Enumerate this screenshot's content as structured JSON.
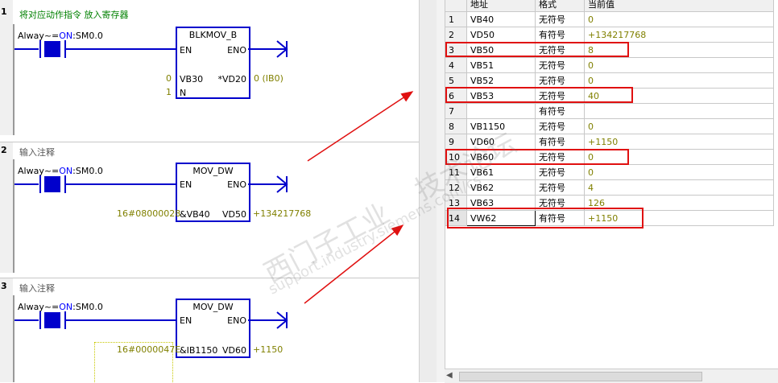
{
  "networks": [
    {
      "number": "1",
      "comment": "将对应动作指令 放入寄存器",
      "comment_color": "#008000",
      "contact": {
        "prefix": "Alway~=",
        "state": "ON",
        "address": ":SM0.0"
      },
      "block": {
        "title": "BLKMOV_B",
        "en": "EN",
        "eno": "ENO",
        "in_pin": "VB30",
        "in_value": "0",
        "n_pin": "N",
        "n_value": "1",
        "out_pin": "*VD20",
        "out_value": "0 (IB0)"
      }
    },
    {
      "number": "2",
      "comment": "输入注释",
      "comment_color": "#555555",
      "contact": {
        "prefix": "Alway~=",
        "state": "ON",
        "address": ":SM0.0"
      },
      "block": {
        "title": "MOV_DW",
        "en": "EN",
        "eno": "ENO",
        "in_pin": "&VB40",
        "in_value": "16#08000028",
        "out_pin": "VD50",
        "out_value": "+134217768"
      }
    },
    {
      "number": "3",
      "comment": "输入注释",
      "comment_color": "#555555",
      "contact": {
        "prefix": "Alway~=",
        "state": "ON",
        "address": ":SM0.0"
      },
      "block": {
        "title": "MOV_DW",
        "en": "EN",
        "eno": "ENO",
        "in_pin": "&IB1150",
        "in_value": "16#0000047E",
        "out_pin": "VD60",
        "out_value": "+1150"
      }
    }
  ],
  "status_chart": {
    "headers": {
      "address": "地址",
      "format": "格式",
      "current": "当前值"
    },
    "rows": [
      {
        "n": "1",
        "address": "VB40",
        "format": "无符号",
        "value": "0"
      },
      {
        "n": "2",
        "address": "VD50",
        "format": "有符号",
        "value": "+134217768"
      },
      {
        "n": "3",
        "address": "VB50",
        "format": "无符号",
        "value": "8"
      },
      {
        "n": "4",
        "address": "VB51",
        "format": "无符号",
        "value": "0"
      },
      {
        "n": "5",
        "address": "VB52",
        "format": "无符号",
        "value": "0"
      },
      {
        "n": "6",
        "address": "VB53",
        "format": "无符号",
        "value": "40"
      },
      {
        "n": "7",
        "address": "",
        "format": "有符号",
        "value": ""
      },
      {
        "n": "8",
        "address": "VB1150",
        "format": "无符号",
        "value": "0"
      },
      {
        "n": "9",
        "address": "VD60",
        "format": "有符号",
        "value": "+1150"
      },
      {
        "n": "10",
        "address": "VB60",
        "format": "无符号",
        "value": "0"
      },
      {
        "n": "11",
        "address": "VB61",
        "format": "无符号",
        "value": "0"
      },
      {
        "n": "12",
        "address": "VB62",
        "format": "无符号",
        "value": "4"
      },
      {
        "n": "13",
        "address": "VB63",
        "format": "无符号",
        "value": "126"
      },
      {
        "n": "14",
        "address": "VW62",
        "format": "有符号",
        "value": "+1150"
      }
    ]
  },
  "watermark": {
    "line1": "西门子工业",
    "line2": "support.industry.siemens.com/cs",
    "line3": "技术论坛"
  },
  "colors": {
    "wire": "#0000cc",
    "value_text": "#808000",
    "highlight": "#e01010",
    "on_state": "#0000ff"
  }
}
